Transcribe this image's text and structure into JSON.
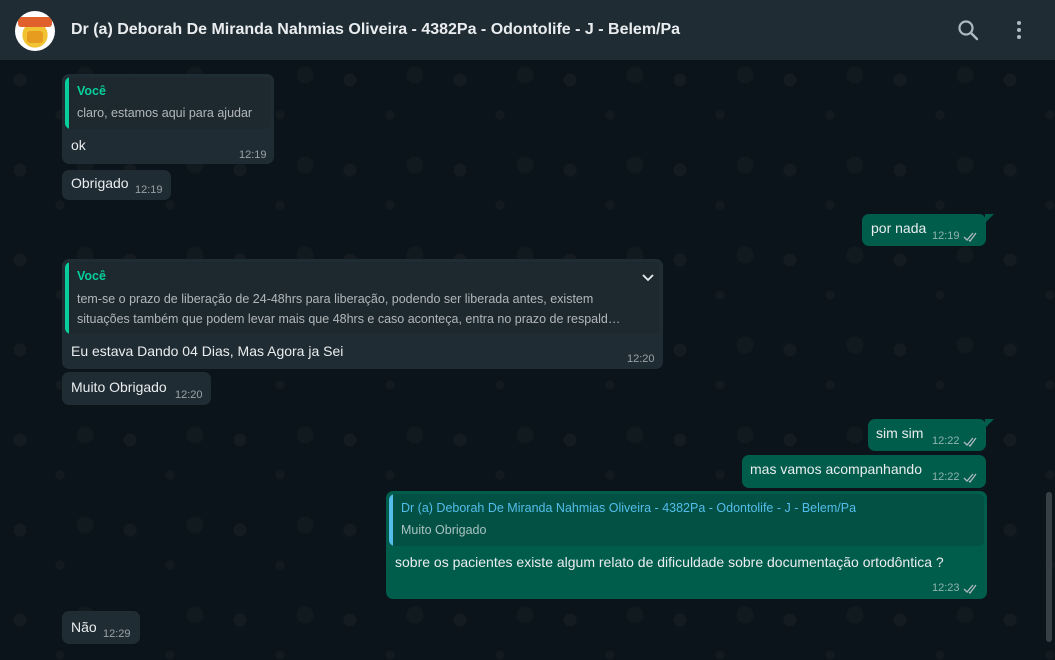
{
  "header": {
    "title": "Dr (a) Deborah De Miranda Nahmias Oliveira - 4382Pa - Odontolife - J - Belem/Pa",
    "avatar_icon": "contact-avatar",
    "search_icon": "search-icon",
    "menu_icon": "more-vertical-icon"
  },
  "colors": {
    "accent": "#06cf9c",
    "incoming_bubble": "#202c33",
    "outgoing_bubble": "#005c4b",
    "quote_contact": "#53bdeb",
    "background": "#0b141a"
  },
  "messages": [
    {
      "direction": "in",
      "quote": {
        "author": "Você",
        "text": "claro, estamos aqui para ajudar"
      },
      "text": "ok",
      "time": "12:19"
    },
    {
      "direction": "in",
      "text": "Obrigado",
      "time": "12:19"
    },
    {
      "direction": "out",
      "text": "por nada",
      "time": "12:19",
      "status": "read"
    },
    {
      "direction": "in",
      "quote": {
        "author": "Você",
        "line1": "tem-se o prazo de liberação de 24-48hrs para liberação, podendo ser liberada antes, existem",
        "line2": "situações também que podem levar mais que 48hrs e caso aconteça, entra no prazo de respald…"
      },
      "text": "Eu estava Dando 04 Dias, Mas Agora ja Sei",
      "time": "12:20"
    },
    {
      "direction": "in",
      "text": "Muito Obrigado",
      "time": "12:20"
    },
    {
      "direction": "out",
      "text": "sim sim",
      "time": "12:22",
      "status": "read"
    },
    {
      "direction": "out",
      "text": "mas vamos acompanhando",
      "time": "12:22",
      "status": "read"
    },
    {
      "direction": "out",
      "quote": {
        "author": "Dr (a) Deborah De Miranda Nahmias Oliveira - 4382Pa - Odontolife - J - Belem/Pa",
        "text": "Muito Obrigado"
      },
      "text": "sobre os pacientes existe algum relato de dificuldade sobre documentação ortodôntica ?",
      "time": "12:23",
      "status": "read"
    },
    {
      "direction": "in",
      "text": "Não",
      "time": "12:29"
    }
  ]
}
